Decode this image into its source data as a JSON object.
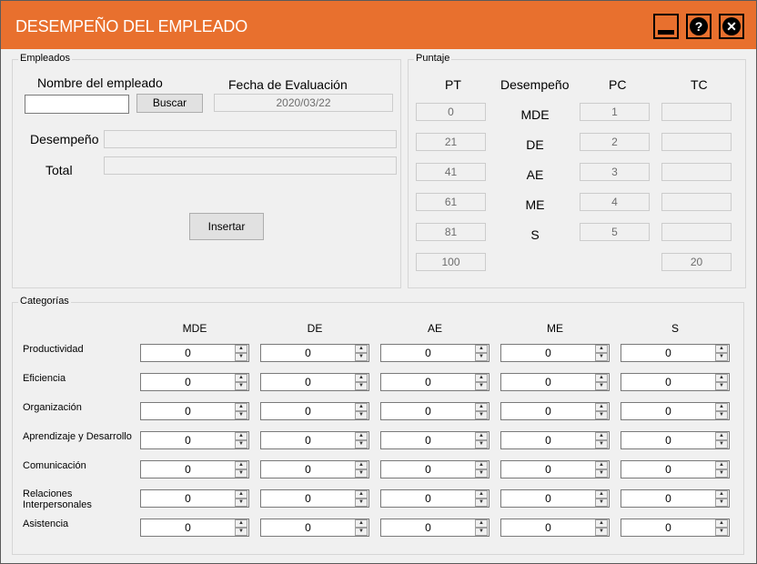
{
  "window": {
    "title": "DESEMPEÑO DEL EMPLEADO",
    "accent_color": "#e8702e",
    "buttons": {
      "help": "?",
      "close": "✕"
    }
  },
  "empleados": {
    "group_label": "Empleados",
    "nombre_label": "Nombre del empleado",
    "nombre_value": "",
    "buscar_label": "Buscar",
    "fecha_label": "Fecha de Evaluación",
    "fecha_value": "2020/03/22",
    "desempeno_label": "Desempeño",
    "desempeno_value": "",
    "total_label": "Total",
    "total_value": "",
    "insertar_label": "Insertar"
  },
  "puntaje": {
    "group_label": "Puntaje",
    "headers": {
      "pt": "PT",
      "desempeno": "Desempeño",
      "pc": "PC",
      "tc": "TC"
    },
    "rows": [
      {
        "pt": "0",
        "desempeno": "MDE",
        "pc": "1",
        "tc": ""
      },
      {
        "pt": "21",
        "desempeno": "DE",
        "pc": "2",
        "tc": ""
      },
      {
        "pt": "41",
        "desempeno": "AE",
        "pc": "3",
        "tc": ""
      },
      {
        "pt": "61",
        "desempeno": "ME",
        "pc": "4",
        "tc": ""
      },
      {
        "pt": "81",
        "desempeno": "S",
        "pc": "5",
        "tc": ""
      }
    ],
    "pt_total": "100",
    "tc_total": "20"
  },
  "categorias": {
    "group_label": "Categorías",
    "columns": [
      "MDE",
      "DE",
      "AE",
      "ME",
      "S"
    ],
    "rows": [
      {
        "label": "Productividad",
        "values": [
          "0",
          "0",
          "0",
          "0",
          "0"
        ]
      },
      {
        "label": "Eficiencia",
        "values": [
          "0",
          "0",
          "0",
          "0",
          "0"
        ]
      },
      {
        "label": "Organización",
        "values": [
          "0",
          "0",
          "0",
          "0",
          "0"
        ]
      },
      {
        "label": "Aprendizaje y Desarrollo",
        "values": [
          "0",
          "0",
          "0",
          "0",
          "0"
        ]
      },
      {
        "label": "Comunicación",
        "values": [
          "0",
          "0",
          "0",
          "0",
          "0"
        ]
      },
      {
        "label": "Relaciones\nInterpersonales",
        "values": [
          "0",
          "0",
          "0",
          "0",
          "0"
        ]
      },
      {
        "label": "Asistencia",
        "values": [
          "0",
          "0",
          "0",
          "0",
          "0"
        ]
      }
    ]
  }
}
